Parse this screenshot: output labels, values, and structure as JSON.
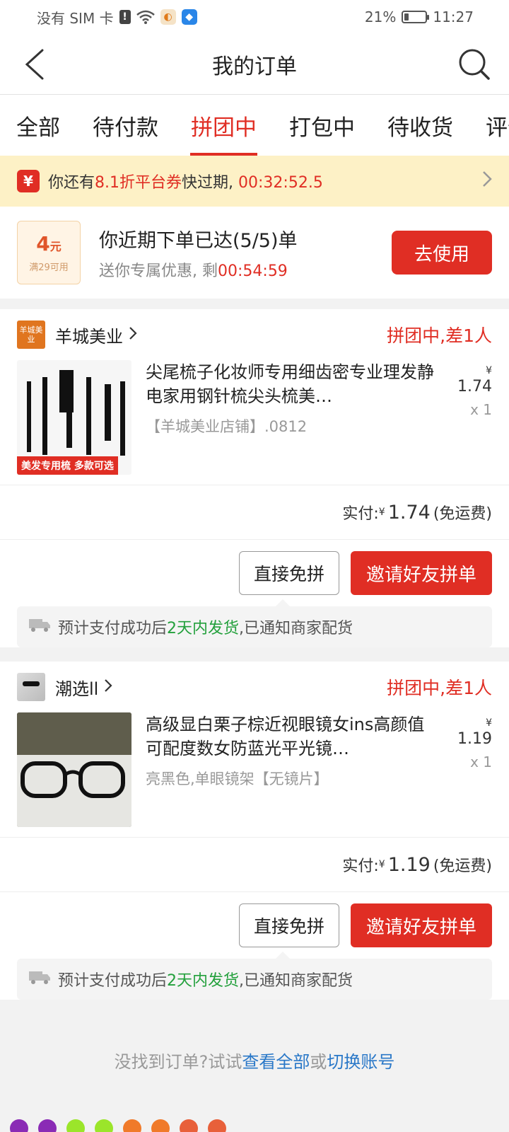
{
  "status_bar": {
    "carrier": "没有 SIM 卡",
    "battery": "21%",
    "battery_level": 0.21,
    "time": "11:27",
    "icons": [
      "exclamation-icon",
      "wifi-icon",
      "app-notification-icon",
      "app-shield-icon"
    ]
  },
  "nav": {
    "title": "我的订单",
    "back_icon": "back-arrow-icon",
    "search_icon": "search-icon"
  },
  "tabs": [
    {
      "label": "全部"
    },
    {
      "label": "待付款"
    },
    {
      "label": "拼团中",
      "active": true
    },
    {
      "label": "打包中"
    },
    {
      "label": "待收货"
    },
    {
      "label": "评价"
    }
  ],
  "banner": {
    "badge": "¥",
    "pre": "你还有",
    "highlight": "8.1折平台券",
    "mid": "快过期,",
    "timer": "00:32:52.5"
  },
  "promo": {
    "amount": "4",
    "unit": "元",
    "condition": "满29可用",
    "title": "你近期下单已达(5/5)单",
    "sub_pre": "送你专属优惠, 剩",
    "sub_timer": "00:54:59",
    "button": "去使用"
  },
  "orders": [
    {
      "shop_logo": "羊城美业",
      "shop_name": "羊城美业",
      "status": "拼团中,差1人",
      "title": "尖尾梳子化妆师专用细齿密专业理发静电家用钢针梳尖头梳美…",
      "spec": "【羊城美业店铺】.0812",
      "price": "1.74",
      "currency": "¥",
      "qty": "x 1",
      "thumb_caption": "美发专用梳 多款可选",
      "total_label": "实付:",
      "total": "1.74",
      "shipping": "(免运费)",
      "btn_direct": "直接免拼",
      "btn_invite": "邀请好友拼单",
      "delivery_pre": "预计支付成功后",
      "delivery_highlight": "2天内发货",
      "delivery_post": ",已通知商家配货"
    },
    {
      "shop_name": "潮选ll",
      "status": "拼团中,差1人",
      "title": "高级显白栗子棕近视眼镜女ins高颜值可配度数女防蓝光平光镜…",
      "spec": "亮黑色,单眼镜架【无镜片】",
      "price": "1.19",
      "currency": "¥",
      "qty": "x 1",
      "total_label": "实付:",
      "total": "1.19",
      "shipping": "(免运费)",
      "btn_direct": "直接免拼",
      "btn_invite": "邀请好友拼单",
      "delivery_pre": "预计支付成功后",
      "delivery_highlight": "2天内发货",
      "delivery_post": ",已通知商家配货"
    }
  ],
  "footer": {
    "pre": "没找到订单?试试",
    "link1": "查看全部",
    "mid": "或",
    "link2": "切换账号"
  },
  "colors": {
    "accent": "#e02e24",
    "green": "#23a03c",
    "link": "#2a78c8",
    "banner_bg": "#fdf1c6"
  }
}
